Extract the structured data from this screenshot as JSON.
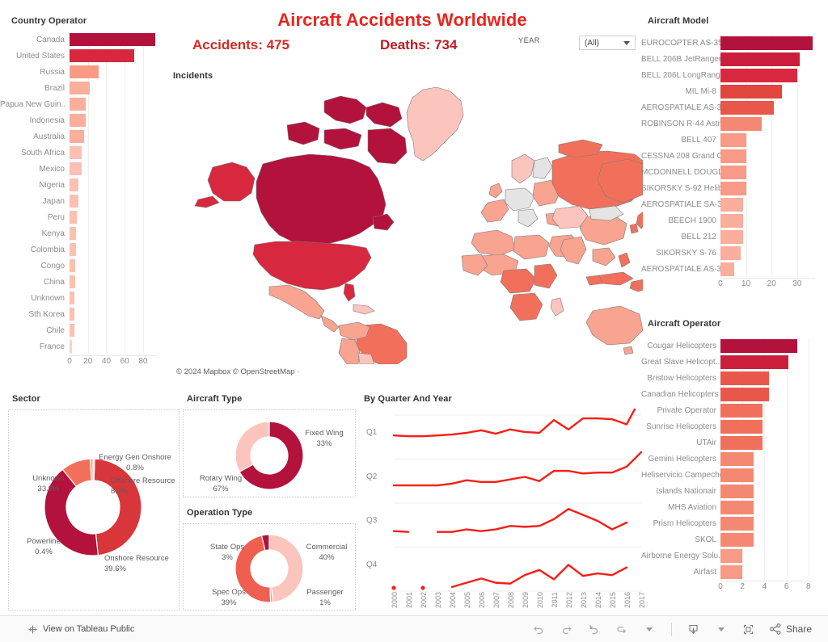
{
  "header": {
    "title": "Aircraft Accidents Worldwide",
    "kpi_accidents": "Accidents: 475",
    "kpi_deaths": "Deaths: 734",
    "year_filter_label": "YEAR",
    "year_filter_value": "(All)",
    "title_color": "#e8251f"
  },
  "map": {
    "panel_title": "Incidents",
    "attribution": "© 2024 Mapbox  © OpenStreetMap ·"
  },
  "country_operator": {
    "panel_title": "Country Operator",
    "chart_data": {
      "type": "bar",
      "title": "Country Operator",
      "orientation": "horizontal",
      "categories": [
        "Canada",
        "United States",
        "Russia",
        "Brazil",
        "Papua New Guin..",
        "Indonesia",
        "Australia",
        "South Africa",
        "Mexico",
        "Nigeria",
        "Japan",
        "Peru",
        "Kenya",
        "Colombia",
        "Congo",
        "China",
        "Unknown",
        "Sth Korea",
        "Chile",
        "France"
      ],
      "values": [
        93,
        70,
        32,
        22,
        18,
        18,
        16,
        13,
        13,
        10,
        10,
        8,
        7,
        7,
        6,
        6,
        5,
        5,
        5,
        3
      ],
      "xlabel": "",
      "ylabel": "",
      "xlim": [
        0,
        95
      ],
      "ticks": [
        0,
        20,
        40,
        60,
        80
      ],
      "grid": true
    }
  },
  "aircraft_model": {
    "panel_title": "Aircraft Model",
    "chart_data": {
      "type": "bar",
      "title": "Aircraft Model",
      "orientation": "horizontal",
      "categories": [
        "EUROCOPTER AS-35..",
        "BELL 206B JetRanger",
        "BELL 206L LongRang..",
        "MIL Mi-8",
        "AEROSPATIALE AS-3..",
        "ROBINSON R-44 Astro",
        "BELL 407",
        "CESSNA 208 Grand C..",
        "MCDONNELL DOUGL..",
        "SIKORSKY S-92 Helib..",
        "AEROSPATIALE SA-3..",
        "BEECH 1900",
        "BELL 212",
        "SIKORSKY S-76",
        "AEROSPATIALE AS-3.."
      ],
      "values": [
        36,
        31,
        30,
        24,
        21,
        16,
        10,
        10,
        10,
        10,
        9,
        9,
        9,
        8,
        5.5
      ],
      "xlabel": "",
      "ylabel": "",
      "xlim": [
        0,
        37
      ],
      "ticks": [
        0,
        10,
        20,
        30
      ],
      "grid": true
    }
  },
  "aircraft_operator": {
    "panel_title": "Aircraft Operator",
    "chart_data": {
      "type": "bar",
      "title": "Aircraft Operator",
      "orientation": "horizontal",
      "categories": [
        "Cougar Helicopters",
        "Great Slave Helicopt..",
        "Bristow Helicopters",
        "Canadian Helicopters",
        "Private Operator",
        "Sunrise Helicopters",
        "UTAir",
        "Gemini Helicopters",
        "Heliservicio Campeche",
        "Islands Nationair",
        "MHS Aviation",
        "Prism Helicopters",
        "SKOL",
        "Airborne Energy Solu..",
        "Airfast"
      ],
      "values": [
        7,
        6.2,
        4.4,
        4.4,
        3.8,
        3.8,
        3.8,
        3,
        3,
        3,
        3,
        3,
        3,
        2,
        2
      ],
      "xlabel": "",
      "ylabel": "",
      "xlim": [
        0,
        8.6
      ],
      "ticks": [
        0,
        2,
        4,
        6,
        8
      ],
      "grid": true
    }
  },
  "sector": {
    "panel_title": "Sector",
    "chart_data": {
      "type": "pie",
      "title": "Sector",
      "labels": [
        "Onshore Resource",
        "Unknown",
        "Offshore Resource",
        "Energy Gen Onshore",
        "Powerline"
      ],
      "values": [
        39.6,
        33.9,
        8.2,
        0.8,
        0.4
      ],
      "value_labels": [
        "39.6%",
        "33.9%",
        "8.2%",
        "0.8%",
        "0.4%"
      ],
      "colors": [
        "#d8363a",
        "#b3123c",
        "#f2705b",
        "#f8a48e",
        "#f5b0a0"
      ],
      "donut": true
    }
  },
  "aircraft_type": {
    "panel_title": "Aircraft Type",
    "chart_data": {
      "type": "pie",
      "title": "Aircraft Type",
      "labels": [
        "Rotary Wing",
        "Fixed Wing"
      ],
      "values": [
        67,
        33
      ],
      "value_labels": [
        "67%",
        "33%"
      ],
      "colors": [
        "#b3123c",
        "#fbc5bd"
      ],
      "donut": true
    }
  },
  "operation_type": {
    "panel_title": "Operation Type",
    "chart_data": {
      "type": "pie",
      "title": "Operation Type",
      "labels": [
        "Commercial",
        "Passenger",
        "Spec Ops",
        "State Ops"
      ],
      "values": [
        40,
        1,
        39,
        3
      ],
      "value_labels": [
        "40%",
        "1%",
        "39%",
        "3%"
      ],
      "colors": [
        "#fbc5bd",
        "#f79b8a",
        "#ef5f50",
        "#b3123c"
      ],
      "donut": true
    }
  },
  "by_quarter_and_year": {
    "panel_title": "By Quarter And Year",
    "chart_data": {
      "type": "line",
      "title": "By Quarter And Year",
      "rows": [
        "Q1",
        "Q2",
        "Q3",
        "Q4"
      ],
      "x": [
        "2000",
        "2001",
        "2002",
        "2003",
        "2004",
        "2005",
        "2006",
        "2007",
        "2008",
        "2009",
        "2010",
        "2011",
        "2012",
        "2013",
        "2014",
        "2015",
        "2016",
        "2017"
      ],
      "series": [
        {
          "name": "Q1",
          "values": [
            5,
            4.8,
            4.8,
            5,
            5.2,
            5.6,
            6.2,
            5.4,
            6.4,
            5.8,
            5.6,
            8.6,
            6.4,
            9,
            9,
            8.8,
            7.6,
            14
          ]
        },
        {
          "name": "Q2",
          "values": [
            3.6,
            3.6,
            3.6,
            3.6,
            4,
            4.8,
            4.4,
            4.4,
            5,
            5.6,
            4.6,
            7,
            7,
            6.4,
            6.6,
            6.6,
            8,
            11.4
          ]
        },
        {
          "name": "Q3",
          "values": [
            3.2,
            3,
            null,
            3,
            3,
            3.6,
            3.2,
            3.6,
            4.4,
            4.2,
            4.4,
            6,
            8.4,
            7,
            5.6,
            3.6,
            5.2,
            null
          ]
        },
        {
          "name": "Q4",
          "values": [
            0.2,
            null,
            0.2,
            null,
            0.4,
            1.4,
            2.4,
            1.4,
            1.2,
            3.2,
            4.4,
            2.2,
            5.6,
            3,
            3.6,
            3.2,
            5,
            null
          ]
        }
      ],
      "line_color": "#f41f16",
      "grid": true,
      "legend": "none"
    }
  },
  "toolbar": {
    "tableau_link": "View on Tableau Public",
    "undo": "Undo",
    "redo": "Redo",
    "revert": "Revert",
    "refresh": "Refresh",
    "download": "Download",
    "fullscreen": "Full Screen",
    "share": "Share"
  },
  "palette": {
    "dark": "#b3123c",
    "mid_dark": "#d8283f",
    "mid": "#e8473f",
    "mid_light": "#f2705b",
    "light": "#f9a391",
    "lightest": "#fbc5bd",
    "grey": "#e4e4e4"
  }
}
